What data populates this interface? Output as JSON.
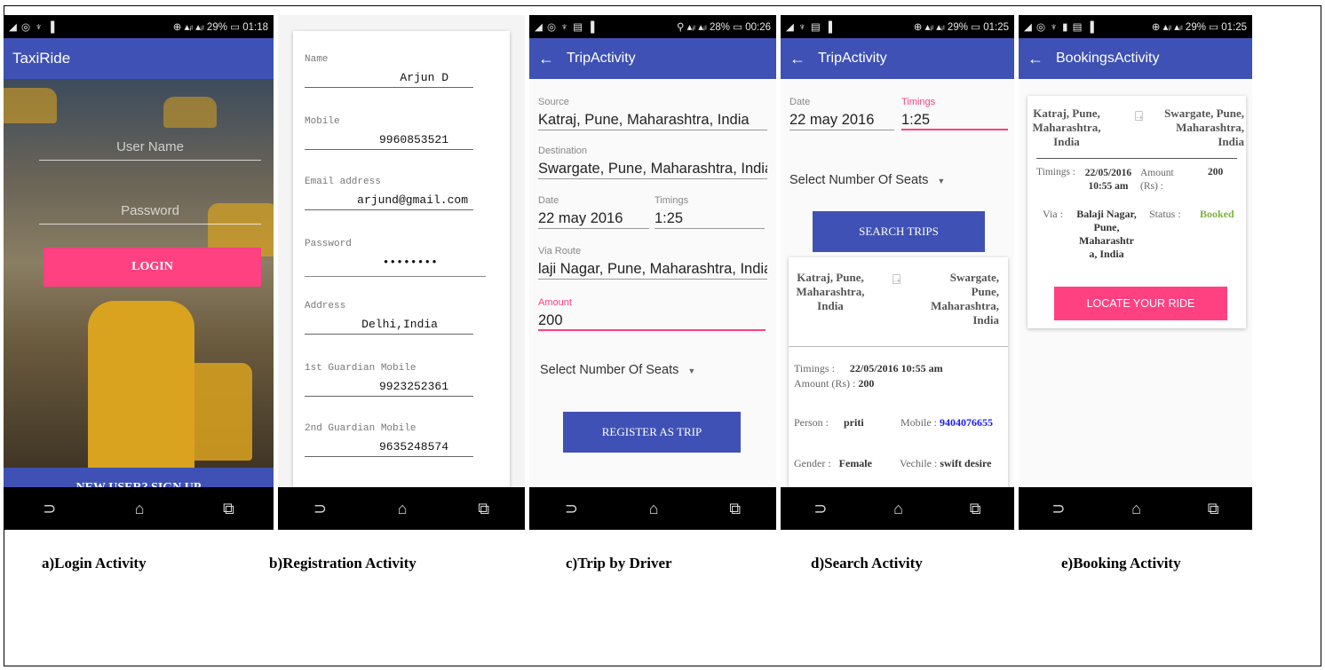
{
  "login": {
    "status": {
      "left": "◢ ◎ ♆ ▐",
      "right": "⊕ ▴ᵢₗ ▴ᵢₗ 29% ▭ 01:18"
    },
    "title": "TaxiRide",
    "username_placeholder": "User Name",
    "password_placeholder": "Password",
    "login_label": "LOGIN",
    "signup_label": "NEW USER? SIGN UP",
    "caption": "a)Login Activity"
  },
  "registration": {
    "fields": [
      {
        "label": "Name",
        "value": "Arjun D"
      },
      {
        "label": "Mobile",
        "value": "9960853521"
      },
      {
        "label": "Email address",
        "value": "arjund@gmail.com"
      },
      {
        "label": "Password",
        "value": "••••••••"
      },
      {
        "label": "Address",
        "value": "Delhi,India"
      },
      {
        "label": "1st Guardian Mobile",
        "value": "9923252361"
      },
      {
        "label": "2nd Guardian Mobile",
        "value": "9635248574"
      }
    ],
    "caption": "b)Registration Activity"
  },
  "trip": {
    "status": {
      "left": "◢ ◎ ♆ ▤ ▐",
      "right": "⚲ ▴ᵢₗ ▴ᵢₗ 28% ▭ 00:26"
    },
    "title": "TripActivity",
    "source_label": "Source",
    "source_value": "Katraj, Pune, Maharashtra, India",
    "destination_label": "Destination",
    "destination_value": "Swargate, Pune, Maharashtra, India",
    "date_label": "Date",
    "date_value": "22 may 2016",
    "timings_label": "Timings",
    "timings_value": "1:25",
    "via_label": "Via Route",
    "via_value": "laji Nagar, Pune, Maharashtra, India",
    "amount_label": "Amount",
    "amount_value": "200",
    "seats_label": "Select Number Of Seats",
    "register_label": "REGISTER AS TRIP",
    "caption": "c)Trip by Driver"
  },
  "search": {
    "status": {
      "left": "◢ ♆ ▤ ▐",
      "right": "⊕ ▴ᵢₗ ▴ᵢₗ 29% ▭ 01:25"
    },
    "title": "TripActivity",
    "date_label": "Date",
    "date_value": "22 may 2016",
    "timings_label": "Timings",
    "timings_value": "1:25",
    "seats_label": "Select Number Of Seats",
    "search_label": "SEARCH TRIPS",
    "result": {
      "from": "Katraj, Pune, Maharashtra, India",
      "to": "Swargate, Pune, Maharashtra, India",
      "timings_label": "Timings :",
      "timings_value": "22/05/2016 10:55 am",
      "amount_label": "Amount (Rs) :",
      "amount_value": "200",
      "person_label": "Person :",
      "person_value": "priti",
      "mobile_label": "Mobile :",
      "mobile_value": "9404076655",
      "gender_label": "Gender :",
      "gender_value": "Female",
      "vehicle_label": "Vechile :",
      "vehicle_value": "swift desire"
    },
    "caption": "d)Search Activity"
  },
  "booking": {
    "status": {
      "left": "◢ ◎ ♆ ▮ ▤ ▐",
      "right": "⊕ ▴ᵢₗ ▴ᵢₗ 29% ▭ 01:25"
    },
    "title": "BookingsActivity",
    "from": "Katraj, Pune, Maharashtra, India",
    "to": "Swargate, Pune, Maharashtra, India",
    "timings_label": "Timings :",
    "timings_value": "22/05/2016 10:55 am",
    "amount_label": "Amount (Rs) :",
    "amount_value": "200",
    "via_label": "Via :",
    "via_value": "Balaji Nagar, Pune, Maharashtr a, India",
    "status_label": "Status :",
    "status_value": "Booked",
    "locate_label": "LOCATE YOUR RIDE",
    "caption": "e)Booking Activity"
  },
  "colors": {
    "primary": "#3f51b5",
    "accent": "#ff4081",
    "booked": "#7cb342",
    "mobile_link": "#1a1aff"
  }
}
